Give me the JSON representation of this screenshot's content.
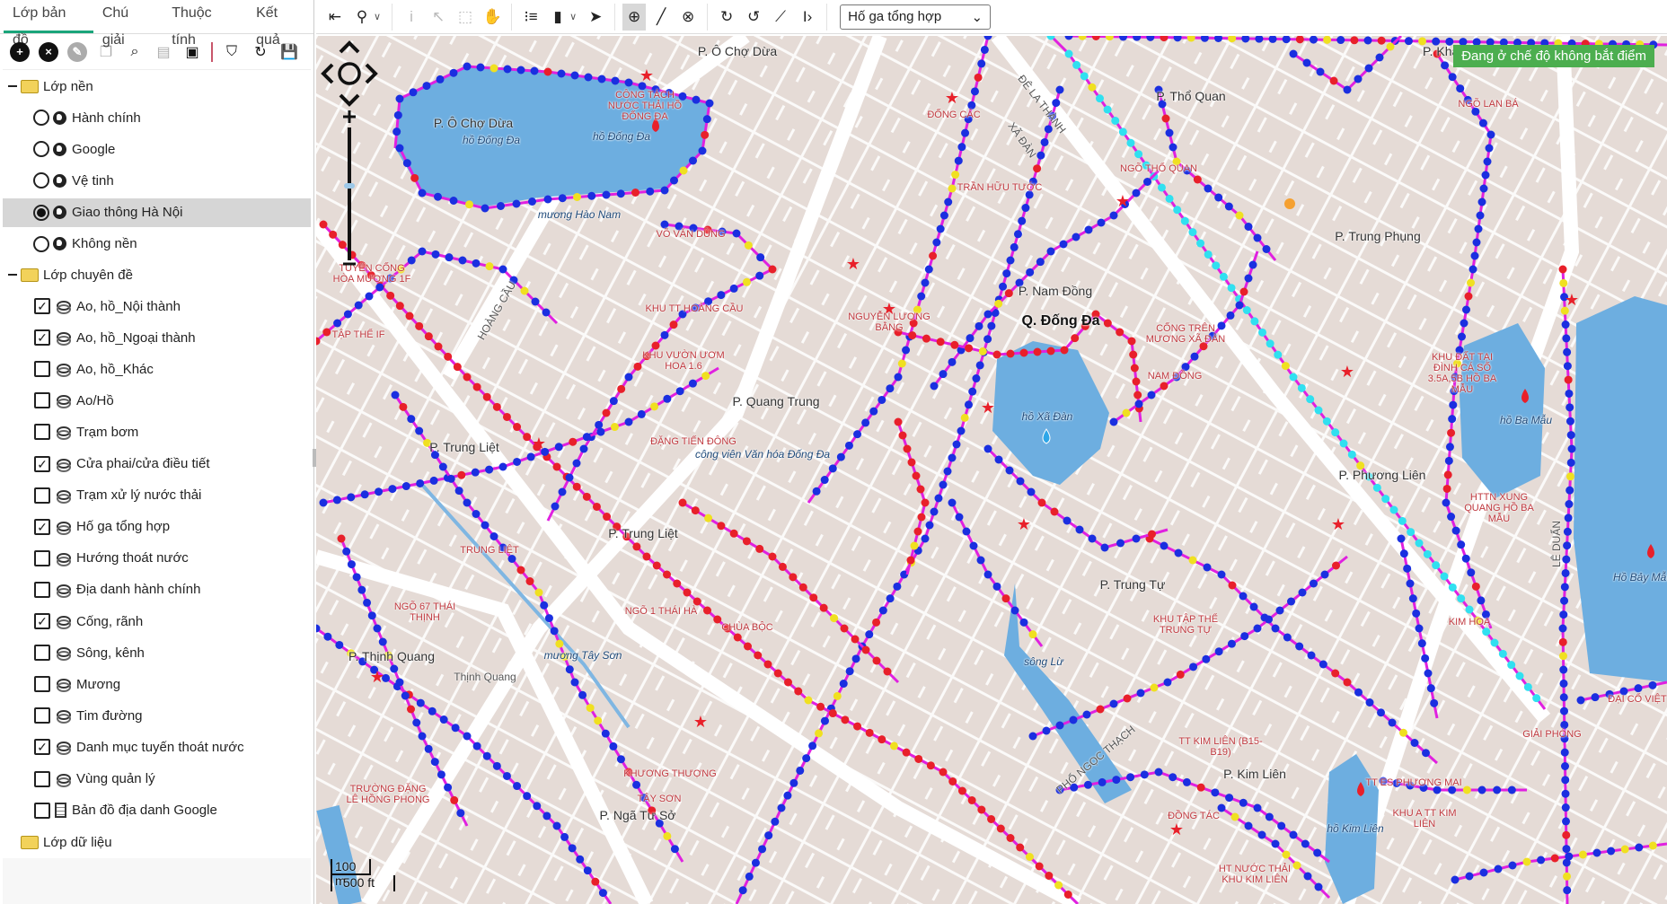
{
  "sidebar": {
    "tabs": [
      {
        "label": "Lớp bản đồ",
        "active": true
      },
      {
        "label": "Chú giải"
      },
      {
        "label": "Thuộc tính"
      },
      {
        "label": "Kết quả"
      }
    ],
    "toolbar_icons": [
      "add-circle-icon",
      "remove-circle-icon",
      "edit-circle-icon",
      "copy-icon",
      "layer-search-icon",
      "table-icon",
      "add-folder-icon",
      "3d-marker-icon",
      "refresh-icon",
      "save-icon"
    ],
    "base_group": {
      "label": "Lớp nền",
      "items": [
        {
          "label": "Hành chính",
          "selected": false
        },
        {
          "label": "Google",
          "selected": false
        },
        {
          "label": "Vệ tinh",
          "selected": false
        },
        {
          "label": "Giao thông Hà Nội",
          "selected": true
        },
        {
          "label": "Không nền",
          "selected": false
        }
      ]
    },
    "theme_group": {
      "label": "Lớp chuyên đề",
      "items": [
        {
          "label": "Ao, hồ_Nội thành",
          "checked": true
        },
        {
          "label": "Ao, hồ_Ngoại thành",
          "checked": true
        },
        {
          "label": "Ao, hồ_Khác",
          "checked": false
        },
        {
          "label": "Ao/Hồ",
          "checked": false
        },
        {
          "label": "Trạm bơm",
          "checked": false
        },
        {
          "label": "Cửa phai/cửa điều tiết",
          "checked": true
        },
        {
          "label": "Trạm xử lý nước thải",
          "checked": false
        },
        {
          "label": "Hố ga tổng hợp",
          "checked": true
        },
        {
          "label": "Hướng thoát nước",
          "checked": false
        },
        {
          "label": "Địa danh hành chính",
          "checked": false
        },
        {
          "label": "Cống, rãnh",
          "checked": true
        },
        {
          "label": "Sông, kênh",
          "checked": false
        },
        {
          "label": "Mương",
          "checked": false
        },
        {
          "label": "Tim đường",
          "checked": false
        },
        {
          "label": "Danh mục tuyến thoát nước",
          "checked": true
        },
        {
          "label": "Vùng quản lý",
          "checked": false
        },
        {
          "label": "Bản đồ địa danh Google",
          "checked": false,
          "icon": "document-icon"
        }
      ]
    },
    "data_group": {
      "label": "Lớp dữ liệu"
    }
  },
  "toolbar": {
    "icons": [
      "exit-icon",
      "marker-icon",
      "info-icon",
      "select-point-icon",
      "select-box-icon",
      "pan-hand-icon",
      "list-icon",
      "ruler-icon",
      "arrow-cursor-icon",
      "add-node-icon",
      "line-icon",
      "delete-node-icon",
      "redo-icon",
      "undo-icon",
      "snap-icon",
      "text-cursor-icon"
    ],
    "layer_select": "Hố ga tổng hợp"
  },
  "map": {
    "status": "Đang ở chế độ không bắt điểm",
    "scale": {
      "metric": "100 m",
      "imperial": "500 ft"
    },
    "colors": {
      "background": "#e5dbd6",
      "water": "#6daee0",
      "pipe": "#e020e0",
      "manhole": "#1a2fe0",
      "red": "#e8202a",
      "yellow": "#f0e020",
      "cyan": "#30e0f0"
    },
    "labels": {
      "l1": "P. Ô Chợ Dừa",
      "l2": "P. Ô Chợ Dừa",
      "l3": "hồ Đống Đa",
      "l4": "hồ Đống Đa",
      "l5": "CÔNG TÁCH NƯỚC THẢI HỒ ĐỐNG ĐA",
      "l6": "ĐỐNG CÁC",
      "l7": "ĐÊ LA THÀNH",
      "l8": "P. Thổ Quan",
      "l9": "P. Khâm",
      "l10": "NGÕ LAN BÁ",
      "l11": "NGÕ THỔ QUAN",
      "l12": "TRẦN HỮU TƯỚC",
      "l13": "P. Trung Phụng",
      "l14": "P. Nam Đồng",
      "l15": "Q. Đống Đa",
      "l16": "VÕ VĂN DŨNG",
      "l17": "TUYẾN CỐNG HÒA MƯƠNG 1F",
      "l18": "TẬP THỂ IF",
      "l19": "KHU TT HOÀNG CẦU",
      "l20": "NGUYỄN LƯƠNG BẰNG",
      "l21": "CỐNG TRÊN MƯƠNG XÃ ĐÀN",
      "l22": "KHU VƯỜN ƯƠM HOA 1.6",
      "l23": "NAM ĐỒNG",
      "l24": "KHU ĐẤT TẠI ĐÌNH CÁ SỐ 3.5A,5B HỒ BA MẪU",
      "l25": "P. Quang Trung",
      "l26": "hồ Xã Đàn",
      "l27": "hồ Ba Mẫu",
      "l28": "ĐẶNG TIẾN ĐÔNG",
      "l29": "P. Trung Liệt",
      "l30": "công viên Văn hóa Đống Đa",
      "l31": "P. Phương Liên",
      "l32": "HTTN XUNG QUANG HỒ BA MẪU",
      "l33": "TRUNG LIỆT",
      "l34": "P. Trung Liệt",
      "l35": "LÊ DUẨN",
      "l36": "P. Trung Tự",
      "l37": "NGÕ 67 THÁI THỊNH",
      "l38": "NGÕ 1 THÁI HÀ",
      "l39": "CHÙA BỘC",
      "l40": "KHU TẬP THỂ TRUNG TỰ",
      "l41": "KIM HOA",
      "l42": "Hồ Bảy Mẫu",
      "l43": "P. Thịnh Quang",
      "l44": "mương Tây Sơn",
      "l45": "Thịnh Quang",
      "l46": "sông Lừ",
      "l47": "ĐẠI CỔ VIỆT",
      "l48": "GIẢI PHÓNG",
      "l49": "TT KIM LIÊN (B15-B19)",
      "l50": "KHƯƠNG THƯỢNG",
      "l51": "P. Kim Liên",
      "l52": "TRƯỜNG ĐẶNG LÊ HỒNG PHONG",
      "l53": "TT ES PHƯƠNG MAI",
      "l54": "TÂY SƠN",
      "l55": "P. Ngã Tư Sở",
      "l56": "ĐỒNG TÁC",
      "l57": "KHU A TT KIM LIÊN",
      "l58": "hồ Kim Liên",
      "l59": "HT NƯỚC THẢI KHU KIM LIÊN",
      "l60": "mương Hào Nam",
      "l61": "HOÀNG CẦU",
      "l62": "XÃ ĐÀN",
      "l63": "PHỐ NGỌC THẠCH"
    }
  }
}
